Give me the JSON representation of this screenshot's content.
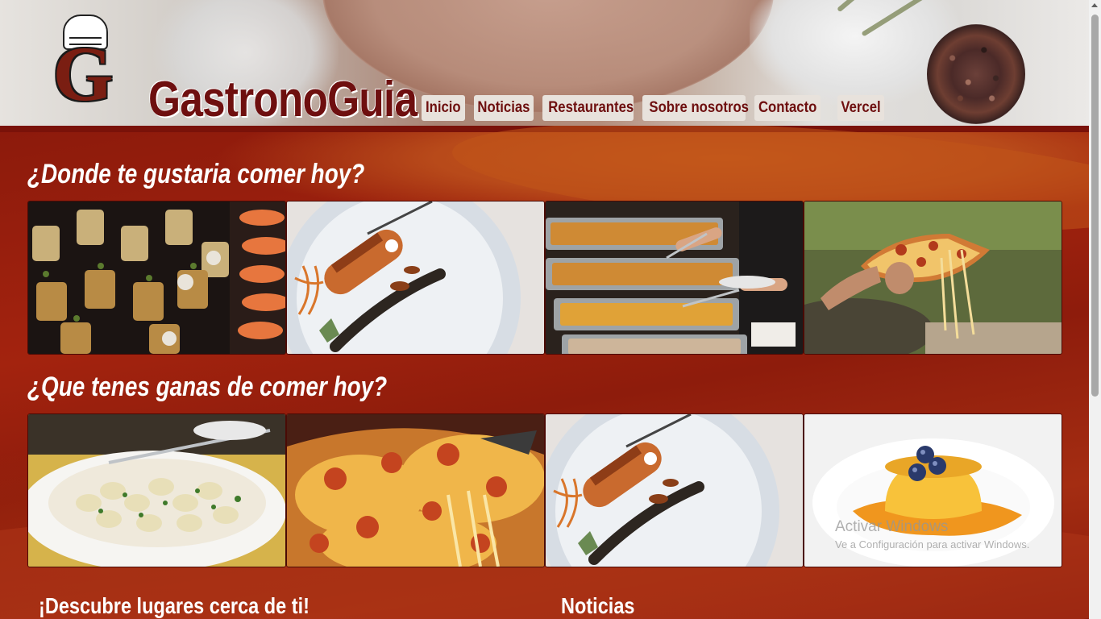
{
  "brand": {
    "name": "GastronoGuia",
    "logo_letter": "G"
  },
  "nav": {
    "items": [
      {
        "label": "Inicio"
      },
      {
        "label": "Noticias"
      },
      {
        "label": "Restaurantes"
      },
      {
        "label": "Sobre nosotros"
      },
      {
        "label": "Contacto"
      },
      {
        "label": "Vercel"
      }
    ]
  },
  "sections": {
    "where": {
      "title": "¿Donde te gustaria comer hoy?",
      "images": [
        "salmon-canapes-photo",
        "gourmet-plate-photo",
        "buffet-trays-photo",
        "pizza-slice-photo"
      ]
    },
    "what": {
      "title": "¿Que tenes ganas de comer hoy?",
      "images": [
        "gnocchi-cream-photo",
        "cheesy-pizza-photo",
        "gourmet-plate-photo",
        "flan-blueberries-photo"
      ]
    }
  },
  "bottom": {
    "discover_title": "¡Descubre lugares cerca de ti!",
    "news_title": "Noticias"
  },
  "watermark": {
    "line1": "Activar Windows",
    "line2": "Ve a Configuración para activar Windows."
  },
  "colors": {
    "brand_dark_red": "#6e0f0f",
    "nav_button_bg": "#e8e2dc",
    "main_bg": "#8e1a0d",
    "accent_orange": "#c1561a"
  }
}
